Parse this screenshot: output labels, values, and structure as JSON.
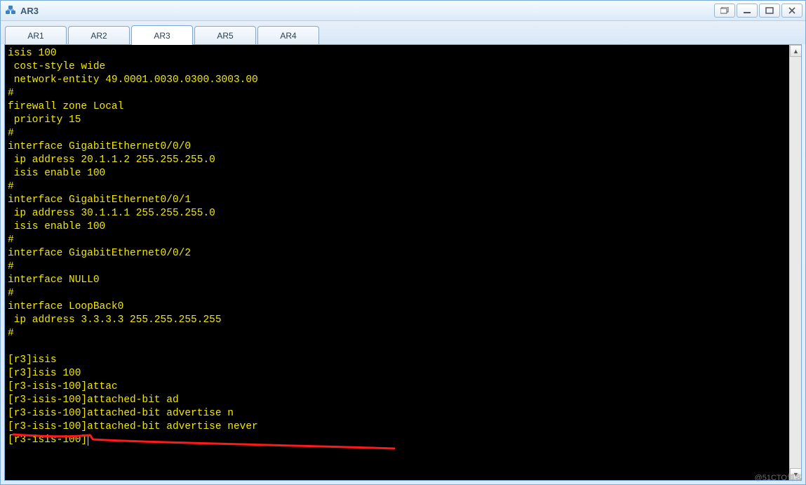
{
  "window": {
    "title": "AR3"
  },
  "tabs": [
    {
      "label": "AR1",
      "active": false
    },
    {
      "label": "AR2",
      "active": false
    },
    {
      "label": "AR3",
      "active": true
    },
    {
      "label": "AR5",
      "active": false
    },
    {
      "label": "AR4",
      "active": false
    }
  ],
  "terminal": {
    "lines": [
      "isis 100",
      " cost-style wide",
      " network-entity 49.0001.0030.0300.3003.00",
      "#",
      "firewall zone Local",
      " priority 15",
      "#",
      "interface GigabitEthernet0/0/0",
      " ip address 20.1.1.2 255.255.255.0",
      " isis enable 100",
      "#",
      "interface GigabitEthernet0/0/1",
      " ip address 30.1.1.1 255.255.255.0",
      " isis enable 100",
      "#",
      "interface GigabitEthernet0/0/2",
      "#",
      "interface NULL0",
      "#",
      "interface LoopBack0",
      " ip address 3.3.3.3 255.255.255.255",
      "#",
      "",
      "[r3]isis",
      "[r3]isis 100",
      "[r3-isis-100]attac",
      "[r3-isis-100]attached-bit ad",
      "[r3-isis-100]attached-bit advertise n",
      "[r3-isis-100]attached-bit advertise never",
      "[r3-isis-100]"
    ]
  },
  "watermark": "@51CTO博客",
  "icons": {
    "restore": "restore-icon",
    "minimize": "minimize-icon",
    "maximize": "maximize-icon",
    "close": "close-icon",
    "scroll_up": "▲",
    "scroll_down": "▼"
  }
}
